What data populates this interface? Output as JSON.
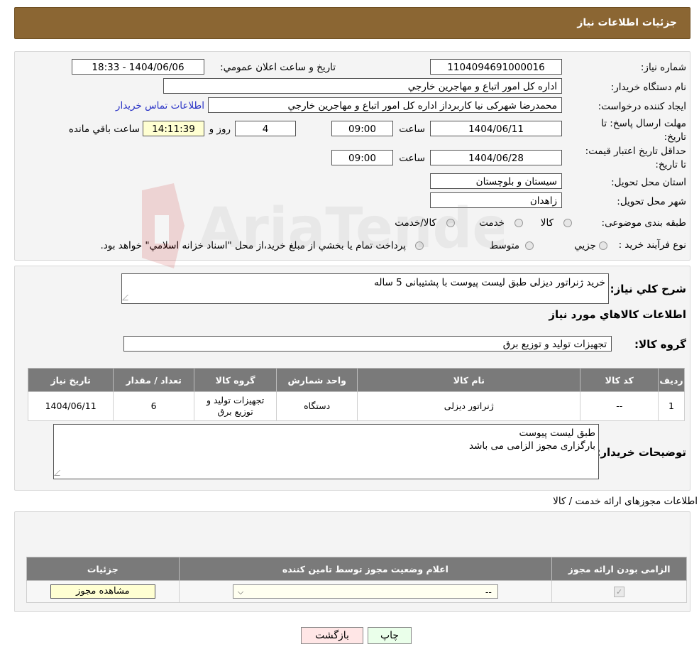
{
  "header": {
    "title": "جزئیات اطلاعات نیاز"
  },
  "form": {
    "need_number_label": "شماره نیاز:",
    "need_number": "1104094691000016",
    "announce_label": "تاریخ و ساعت اعلان عمومي:",
    "announce_value": "1404/06/06 - 18:33",
    "buyer_org_label": "نام دستگاه خريدار:",
    "buyer_org": "اداره کل امور اتباع و مهاجرين خارجي",
    "creator_label": "ايجاد کننده درخواست:",
    "creator": "محمدرضا شهرکی نیا کاربرداز  اداره کل امور اتباع و مهاجرين خارجي",
    "contact_link": "اطلاعات تماس خريدار",
    "deadline_label": "مهلت ارسال پاسخ: تا تاریخ:",
    "deadline_date": "1404/06/11",
    "time_label": "ساعت",
    "deadline_time": "09:00",
    "days_value": "4",
    "days_label": "روز و",
    "remaining_time": "14:11:39",
    "remaining_label": "ساعت باقي مانده",
    "validity_label": "حداقل تاريخ اعتبار قيمت: تا تاريخ:",
    "validity_date": "1404/06/28",
    "validity_time": "09:00",
    "province_label": "استان محل تحويل:",
    "province": "سيستان و بلوچستان",
    "city_label": "شهر محل تحويل:",
    "city": "زاهدان",
    "category_label": "طبقه بندی موضوعی:",
    "category_options": [
      "کالا",
      "خدمت",
      "کالا/خدمت"
    ],
    "process_label": "نوع فرآيند خريد :",
    "process_options": [
      "جزيي",
      "متوسط"
    ],
    "process_note": "پرداخت تمام يا بخشي از مبلغ خريد،از محل \"اسناد خزانه اسلامي\" خواهد بود."
  },
  "details": {
    "desc_label": "شرح کلي نياز:",
    "desc_value": "خرید ژنراتور دیزلی طبق لیست پیوست با پشتیبانی 5 ساله",
    "goods_info_title": "اطلاعات کالاهاي مورد نياز",
    "group_label": "گروه کالا:",
    "group_value": "تجهيزات توليد و توزيع برق",
    "table_headers": [
      "رديف",
      "کد کالا",
      "نام کالا",
      "واحد شمارش",
      "گروه کالا",
      "تعداد / مقدار",
      "تاريخ نياز"
    ],
    "table_rows": [
      {
        "row": "1",
        "code": "--",
        "name": "ژنراتور ديزلی",
        "unit": "دستگاه",
        "group": "تجهيزات توليد و توزيع برق",
        "qty": "6",
        "date": "1404/06/11"
      }
    ],
    "buyer_notes_label": "توضيحات خريدار:",
    "buyer_notes_line1": "طبق لیست پیوست",
    "buyer_notes_line2": "بارگزاری مجوز الزامی می باشد"
  },
  "permits": {
    "title": "اطلاعات مجوزهای ارائه خدمت / کالا",
    "headers": [
      "الزامی بودن ارائه مجوز",
      "اعلام وضعيت مجوز توسط تامين کننده",
      "جزئيات"
    ],
    "select_value": "--",
    "view_button": "مشاهده مجوز"
  },
  "buttons": {
    "print": "چاپ",
    "back": "بازگشت"
  },
  "watermark": {
    "text": "AriaTender.neT"
  }
}
